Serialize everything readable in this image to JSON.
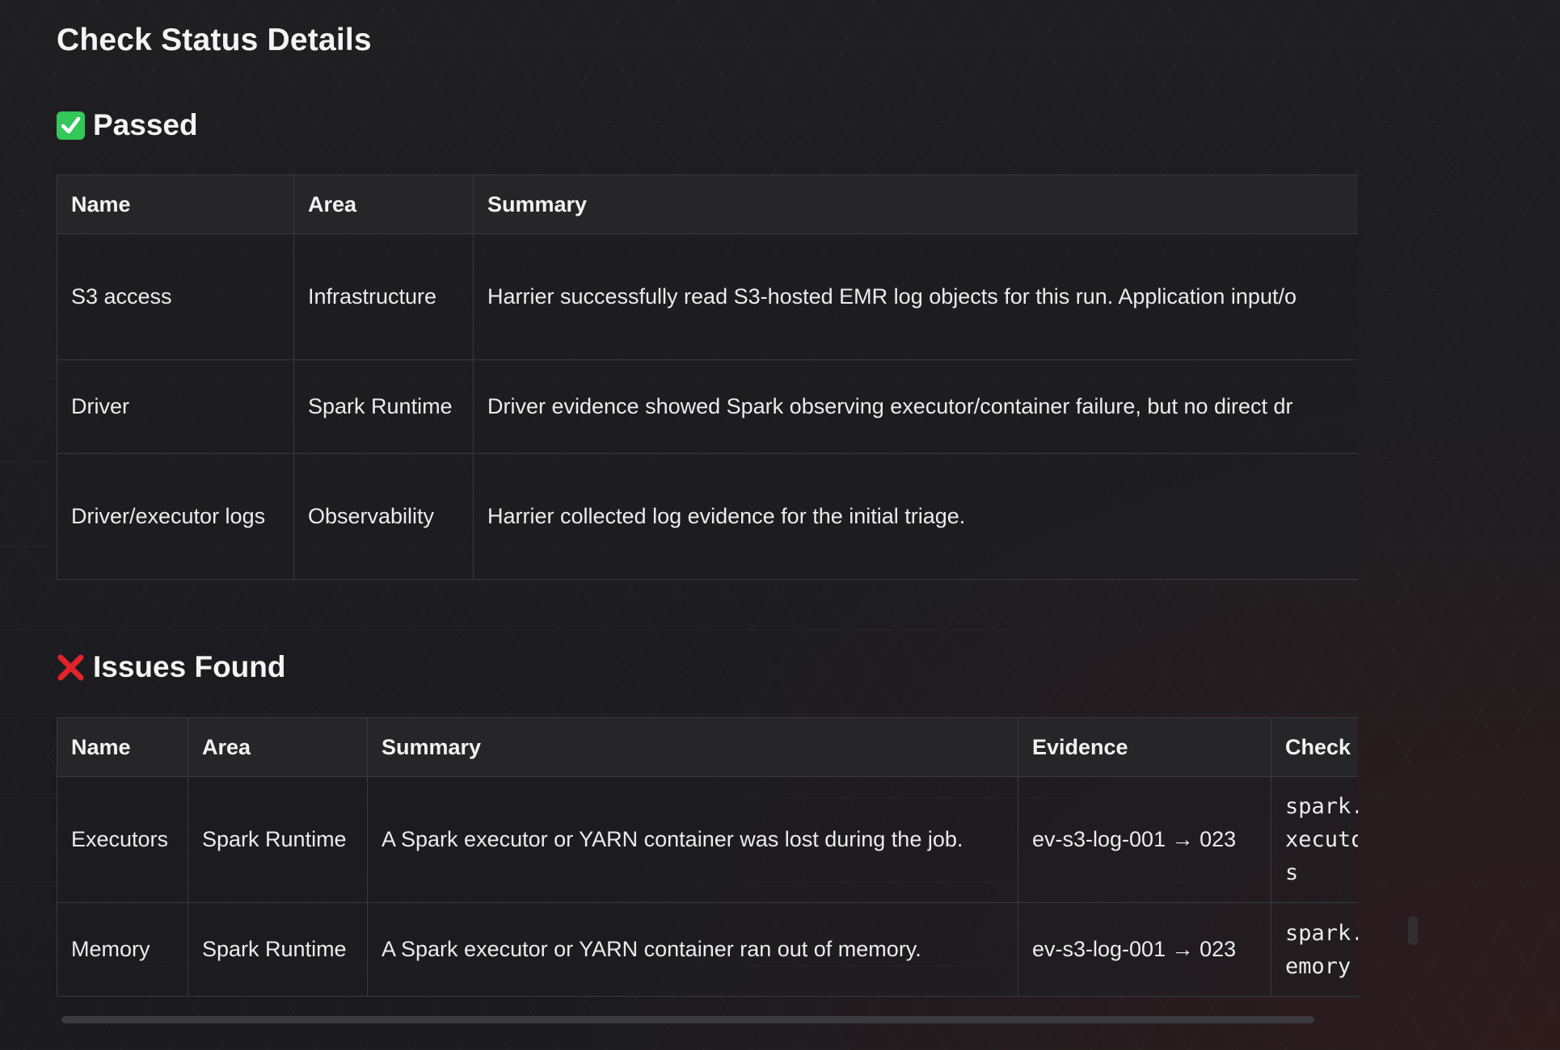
{
  "page": {
    "title": "Check Status Details"
  },
  "passed": {
    "heading": "Passed",
    "icon": "check-mark-button-icon",
    "columns": [
      "Name",
      "Area",
      "Summary"
    ],
    "rows": [
      {
        "name": "S3 access",
        "area": "Infrastructure",
        "summary": "Harrier successfully read S3-hosted EMR log objects for this run. Application input/o"
      },
      {
        "name": "Driver",
        "area": "Spark Runtime",
        "summary": "Driver evidence showed Spark observing executor/container failure, but no direct dr"
      },
      {
        "name": "Driver/executor logs",
        "area": "Observability",
        "summary": "Harrier collected log evidence for the initial triage."
      }
    ]
  },
  "issues": {
    "heading": "Issues Found",
    "icon": "cross-mark-icon",
    "columns": [
      "Name",
      "Area",
      "Summary",
      "Evidence",
      "Check"
    ],
    "rows": [
      {
        "name": "Executors",
        "area": "Spark Runtime",
        "summary": "A Spark executor or YARN container was lost during the job.",
        "evidence": "ev-s3-log-001 → 023",
        "check": "spark.\nxecuto\ns"
      },
      {
        "name": "Memory",
        "area": "Spark Runtime",
        "summary": "A Spark executor or YARN container ran out of memory.",
        "evidence": "ev-s3-log-001 → 023",
        "check": "spark.\nemory"
      }
    ]
  },
  "colors": {
    "background": "#1c1c1f",
    "border": "#3a3a3e",
    "text": "#ececed",
    "check_green": "#34c759",
    "cross_red": "#e0242a"
  }
}
